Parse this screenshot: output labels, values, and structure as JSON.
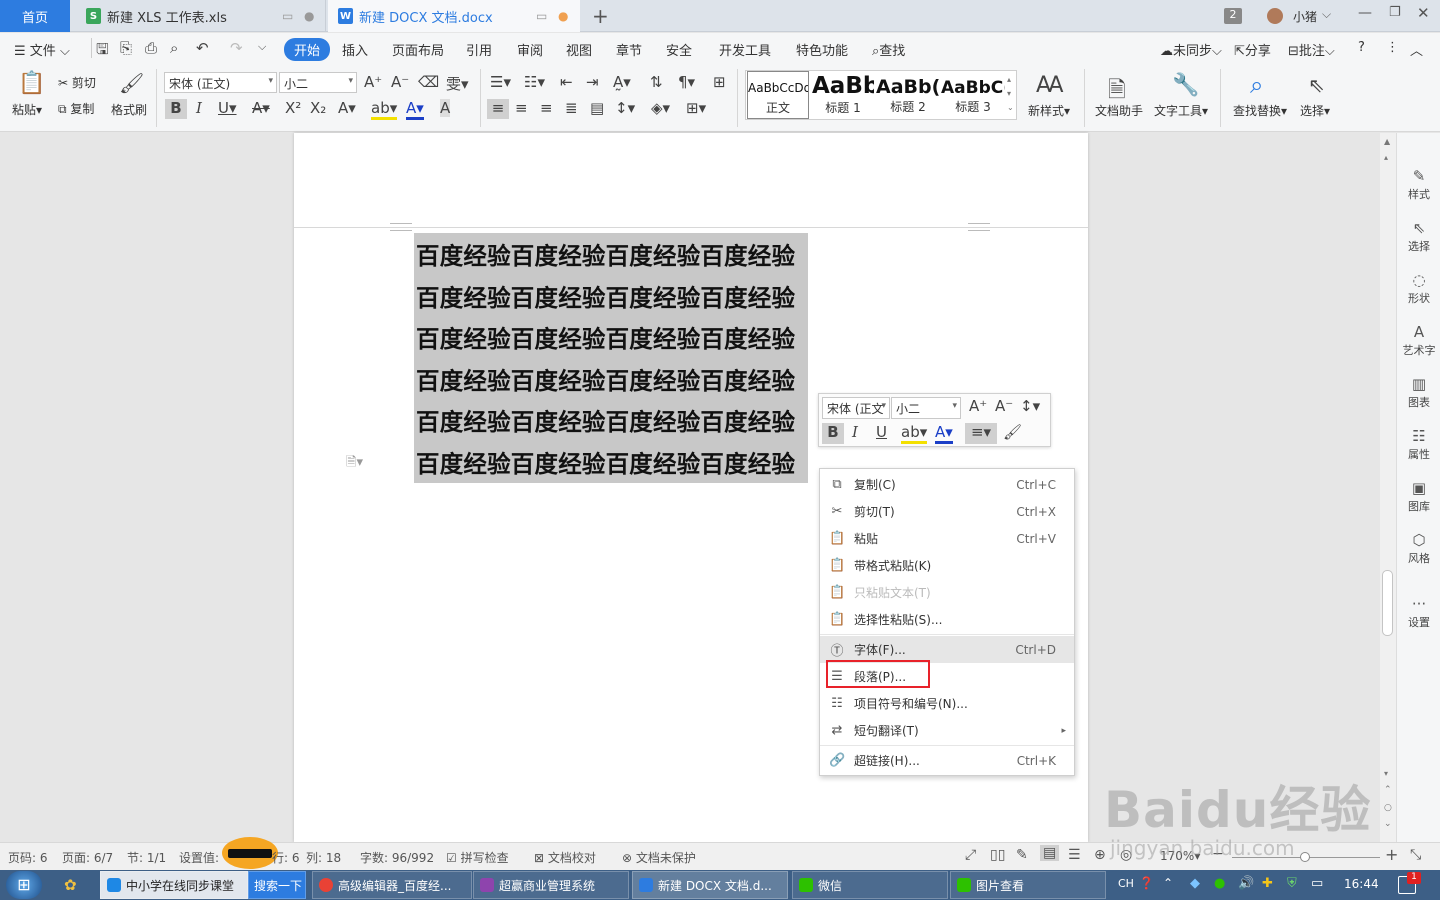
{
  "tabs": {
    "home": "首页",
    "xls": "新建 XLS 工作表.xls",
    "docx": "新建 DOCX 文档.docx",
    "count_badge": "2",
    "user": "小猪"
  },
  "menu": {
    "file": "文件",
    "items": [
      "开始",
      "插入",
      "页面布局",
      "引用",
      "审阅",
      "视图",
      "章节",
      "安全",
      "开发工具",
      "特色功能"
    ],
    "find": "查找",
    "sync": "未同步",
    "share": "分享",
    "comment": "批注"
  },
  "ribbon": {
    "paste": "粘贴",
    "cut": "剪切",
    "copy": "复制",
    "format_painter": "格式刷",
    "font_name": "宋体 (正文)",
    "font_size": "小二",
    "styles": [
      {
        "preview": "AaBbCcDd",
        "label": "正文"
      },
      {
        "preview": "AaBb",
        "label": "标题 1"
      },
      {
        "preview": "AaBb(",
        "label": "标题 2"
      },
      {
        "preview": "AaBbC(",
        "label": "标题 3"
      }
    ],
    "new_style": "新样式",
    "doc_assistant": "文档助手",
    "text_tools": "文字工具",
    "find_replace": "查找替换",
    "select": "选择"
  },
  "document": {
    "lines": [
      "百度经验百度经验百度经验百度经验",
      "百度经验百度经验百度经验百度经验",
      "百度经验百度经验百度经验百度经验",
      "百度经验百度经验百度经验百度经验",
      "百度经验百度经验百度经验百度经验",
      "百度经验百度经验百度经验百度经验"
    ]
  },
  "minibar": {
    "font_name": "宋体 (正文",
    "font_size": "小二"
  },
  "context_menu": [
    {
      "icon": "copy-icon",
      "label": "复制(C)",
      "shortcut": "Ctrl+C",
      "disabled": false
    },
    {
      "icon": "cut-icon",
      "label": "剪切(T)",
      "shortcut": "Ctrl+X",
      "disabled": false
    },
    {
      "icon": "paste-icon",
      "label": "粘贴",
      "shortcut": "Ctrl+V",
      "disabled": false
    },
    {
      "icon": "paste-format-icon",
      "label": "带格式粘贴(K)",
      "shortcut": "",
      "disabled": false
    },
    {
      "icon": "paste-text-icon",
      "label": "只粘贴文本(T)",
      "shortcut": "",
      "disabled": true
    },
    {
      "icon": "paste-special-icon",
      "label": "选择性粘贴(S)...",
      "shortcut": "",
      "disabled": false
    },
    {
      "icon": "font-icon",
      "label": "字体(F)...",
      "shortcut": "Ctrl+D",
      "disabled": false
    },
    {
      "icon": "paragraph-icon",
      "label": "段落(P)...",
      "shortcut": "",
      "disabled": false
    },
    {
      "icon": "bullets-icon",
      "label": "项目符号和编号(N)...",
      "shortcut": "",
      "disabled": false
    },
    {
      "icon": "translate-icon",
      "label": "短句翻译(T)",
      "shortcut": "",
      "disabled": false
    },
    {
      "icon": "link-icon",
      "label": "超链接(H)...",
      "shortcut": "Ctrl+K",
      "disabled": false
    }
  ],
  "right_panel": [
    "样式",
    "选择",
    "形状",
    "艺术字",
    "图表",
    "属性",
    "图库",
    "风格",
    "设置"
  ],
  "status": {
    "page_no": "页码: 6",
    "pages": "页面: 6/7",
    "section": "节: 1/1",
    "setting": "设置值:",
    "row": "行: 6",
    "col": "列: 18",
    "words": "字数: 96/992",
    "spell": "拼写检查",
    "proof": "文档校对",
    "protect": "文档未保护",
    "zoom": "170%"
  },
  "taskbar": {
    "items": [
      "中小学在线同步课堂",
      "搜索一下",
      "高级编辑器_百度经...",
      "超赢商业管理系统",
      "新建 DOCX 文档.d...",
      "微信",
      "图片查看"
    ],
    "lang": "CH",
    "time": "16:44",
    "notif": "1"
  },
  "watermark": {
    "brand": "Baidu经验",
    "url": "jingyan.baidu.com"
  },
  "colors": {
    "accent": "#2d7ce0",
    "highlight_box": "#e8222a",
    "selection": "#c8c8c8"
  }
}
